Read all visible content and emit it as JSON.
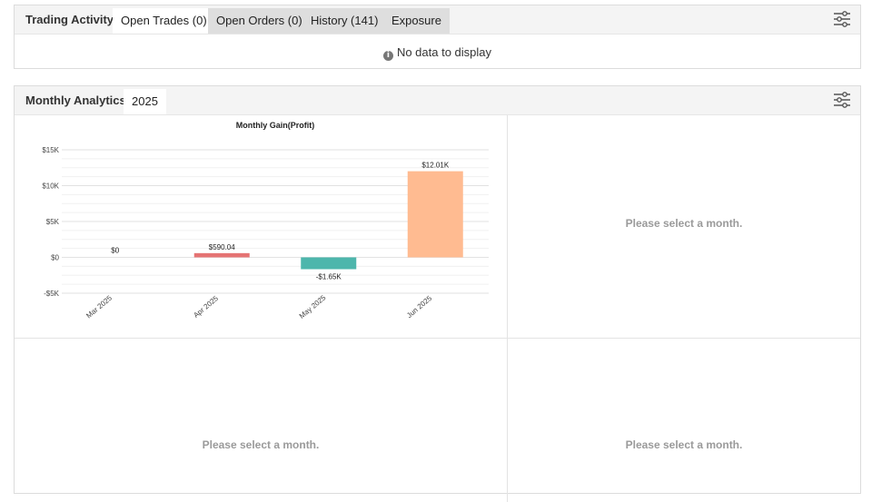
{
  "trading_activity": {
    "title": "Trading Activity",
    "tabs": [
      {
        "label": "Open Trades (0)",
        "active": true
      },
      {
        "label": "Open Orders (0)",
        "active": false
      },
      {
        "label": "History (141)",
        "active": false
      },
      {
        "label": "Exposure",
        "active": false
      }
    ],
    "empty_message": "No data to display",
    "filter_icon": "sliders-icon"
  },
  "monthly_analytics": {
    "title": "Monthly Analytics",
    "year_tab": "2025",
    "filter_icon": "sliders-icon",
    "placeholders": [
      "Please select a month.",
      "Please select a month.",
      "Please select a month."
    ]
  },
  "chart_data": {
    "type": "bar",
    "title": "Monthly Gain(Profit)",
    "xlabel": "",
    "ylabel": "",
    "categories": [
      "Mar 2025",
      "Apr 2025",
      "May 2025",
      "Jun 2025"
    ],
    "values": [
      0,
      590.04,
      -1650,
      12010
    ],
    "data_labels": [
      "$0",
      "$590.04",
      "-$1.65K",
      "$12.01K"
    ],
    "colors": [
      "#e57373",
      "#e57373",
      "#4db6ac",
      "#ffbb91"
    ],
    "ylim": [
      -5000,
      15000
    ],
    "yticks": [
      15000,
      10000,
      5000,
      0,
      -5000
    ],
    "ytick_labels": [
      "$15K",
      "$10K",
      "$5K",
      "$0",
      "-$5K"
    ],
    "grid": true
  }
}
